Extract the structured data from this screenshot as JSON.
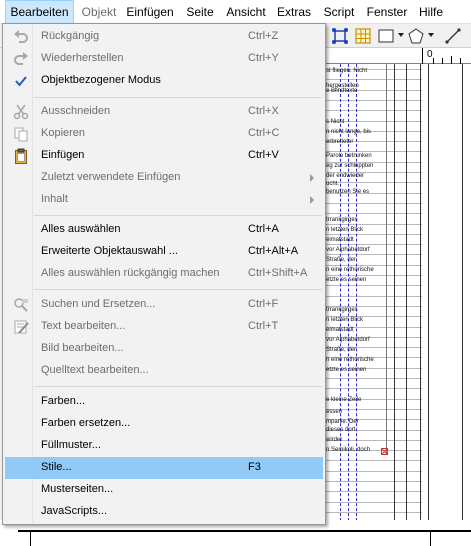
{
  "menubar": {
    "items": [
      {
        "label": "Bearbeiten"
      },
      {
        "label": "Objekt"
      },
      {
        "label": "Einfügen"
      },
      {
        "label": "Seite"
      },
      {
        "label": "Ansicht"
      },
      {
        "label": "Extras"
      },
      {
        "label": "Script"
      },
      {
        "label": "Fenster"
      },
      {
        "label": "Hilfe"
      }
    ]
  },
  "edit_menu": {
    "items": [
      {
        "label": "Rückgängig",
        "shortcut": "Ctrl+Z"
      },
      {
        "label": "Wiederherstellen",
        "shortcut": "Ctrl+Y"
      },
      {
        "label": "Objektbezogener Modus",
        "shortcut": ""
      },
      {
        "label": "Ausschneiden",
        "shortcut": "Ctrl+X"
      },
      {
        "label": "Kopieren",
        "shortcut": "Ctrl+C"
      },
      {
        "label": "Einfügen",
        "shortcut": "Ctrl+V"
      },
      {
        "label": "Zuletzt verwendete Einfügen",
        "shortcut": ""
      },
      {
        "label": "Inhalt",
        "shortcut": ""
      },
      {
        "label": "Alles auswählen",
        "shortcut": "Ctrl+A"
      },
      {
        "label": "Erweiterte Objektauswahl ...",
        "shortcut": "Ctrl+Alt+A"
      },
      {
        "label": "Alles auswählen rückgängig machen",
        "shortcut": "Ctrl+Shift+A"
      },
      {
        "label": "Suchen und Ersetzen...",
        "shortcut": "Ctrl+F"
      },
      {
        "label": "Text bearbeiten...",
        "shortcut": "Ctrl+T"
      },
      {
        "label": "Bild bearbeiten...",
        "shortcut": ""
      },
      {
        "label": "Quelltext bearbeiten...",
        "shortcut": ""
      },
      {
        "label": "Farben...",
        "shortcut": ""
      },
      {
        "label": "Farben ersetzen...",
        "shortcut": ""
      },
      {
        "label": "Füllmuster...",
        "shortcut": ""
      },
      {
        "label": "Stile...",
        "shortcut": "F3"
      },
      {
        "label": "Musterseiten...",
        "shortcut": ""
      },
      {
        "label": "JavaScripts...",
        "shortcut": ""
      }
    ]
  },
  "ruler": {
    "origin_label": "0"
  },
  "document": {
    "lines": [
      "st fliegen. Nicht",
      "hergestellen",
      "e Blindtexte",
      "s Nicht",
      "n nicht lange, bis",
      "erbreiteter",
      "Parole betrunken",
      "eg zur schleppten",
      "der endwieder",
      "ucht.",
      "benutzen Sie es",
      "trrankgirges",
      "n letzten Blick",
      "eimatstadt",
      "vor Alphabetdorf",
      "Straße, der",
      "n eine rethorische",
      "etzte es seinen",
      "trrankgirges",
      "n letzten Blick",
      "eimatstadt",
      "vor Alphabetdorf",
      "Straße, der",
      "n eine rethorische",
      "etzte es seinen",
      "e kleine Zeile",
      "essen",
      "mpanie. Der",
      "dieses dort",
      "wirder",
      "n Semikoli, doch"
    ]
  },
  "colors": {
    "menu_highlight": "#91c9f7",
    "menubar_active": "#cce8ff",
    "overflow_marker": "#e03030"
  }
}
